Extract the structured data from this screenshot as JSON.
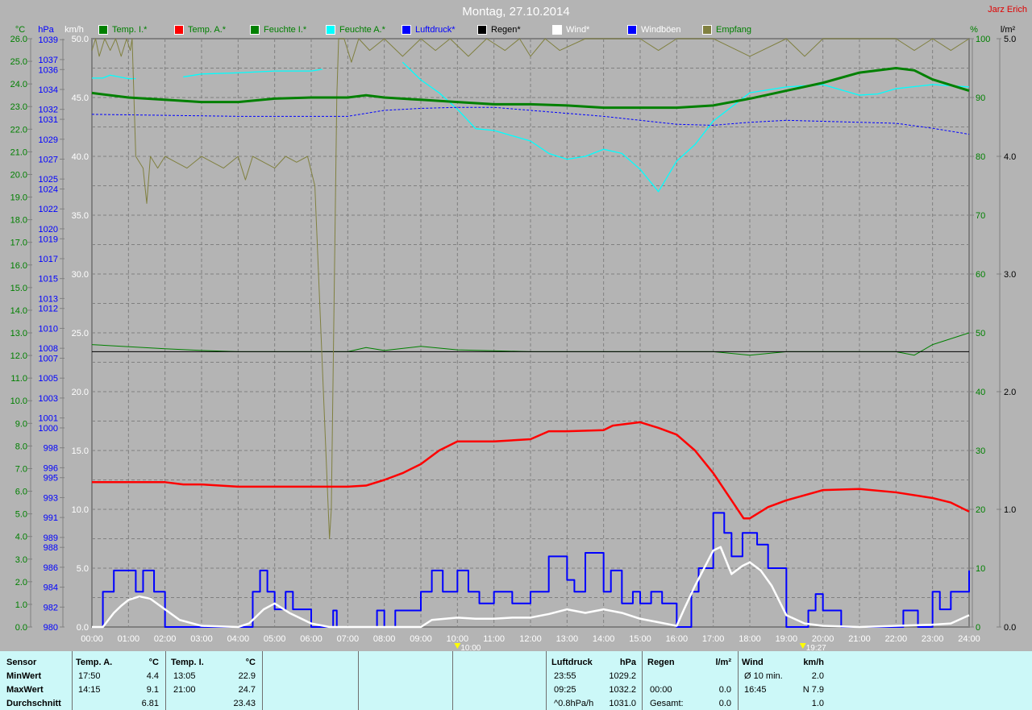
{
  "title": "Montag, 27.10.2014",
  "author": "Jarz Erich",
  "legend": [
    {
      "label": "Temp. I.*",
      "color": "#008000",
      "text_color": "#008000"
    },
    {
      "label": "Temp. A.*",
      "color": "#ff0000",
      "text_color": "#008000"
    },
    {
      "label": "Feuchte I.*",
      "color": "#008000",
      "text_color": "#008000"
    },
    {
      "label": "Feuchte A.*",
      "color": "#00ffff",
      "text_color": "#008000"
    },
    {
      "label": "Luftdruck*",
      "color": "#0000ff",
      "text_color": "#0000ff"
    },
    {
      "label": "Regen*",
      "color": "#000000",
      "text_color": "#000000"
    },
    {
      "label": "Wind*",
      "color": "#ffffff",
      "text_color": "#ffffff"
    },
    {
      "label": "Windböen",
      "color": "#0000ff",
      "text_color": "#ffffff"
    },
    {
      "label": "Empfang",
      "color": "#808040",
      "text_color": "#008000"
    }
  ],
  "chart_data": {
    "type": "line",
    "title": "Montag, 27.10.2014",
    "xlabel": "",
    "x_range": [
      0,
      24
    ],
    "x_ticks": [
      "00:00",
      "01:00",
      "02:00",
      "03:00",
      "04:00",
      "05:00",
      "06:00",
      "07:00",
      "08:00",
      "09:00",
      "10:00",
      "11:00",
      "12:00",
      "13:00",
      "14:00",
      "15:00",
      "16:00",
      "17:00",
      "18:00",
      "19:00",
      "20:00",
      "21:00",
      "22:00",
      "23:00",
      "24:00"
    ],
    "axes": {
      "temp": {
        "unit": "°C",
        "range": [
          0,
          26
        ],
        "ticks": [
          "0.0",
          "1.0",
          "2.0",
          "3.0",
          "4.0",
          "5.0",
          "6.0",
          "7.0",
          "8.0",
          "9.0",
          "10.0",
          "11.0",
          "12.0",
          "13.0",
          "14.0",
          "15.0",
          "16.0",
          "17.0",
          "18.0",
          "19.0",
          "20.0",
          "21.0",
          "22.0",
          "23.0",
          "24.0",
          "25.0",
          "26.0"
        ]
      },
      "pressure": {
        "unit": "hPa",
        "range": [
          980,
          1039.1
        ],
        "ticks": [
          980,
          982,
          984,
          986,
          988,
          989,
          991,
          993,
          995,
          996,
          998,
          1000,
          1001,
          1003,
          1005,
          1007,
          1008,
          1010,
          1012,
          1013,
          1015,
          1017,
          1019,
          1020,
          1022,
          1024,
          1025,
          1027,
          1029,
          1031,
          1032,
          1034,
          1036,
          1037,
          1039
        ]
      },
      "wind": {
        "unit": "km/h",
        "range": [
          0,
          50
        ],
        "ticks": [
          "0.0",
          "5.0",
          "10.0",
          "15.0",
          "20.0",
          "25.0",
          "30.0",
          "35.0",
          "40.0",
          "45.0",
          "50.0"
        ]
      },
      "humidity": {
        "unit": "%",
        "range": [
          0,
          100
        ],
        "ticks": [
          "0",
          "10",
          "20",
          "30",
          "40",
          "50",
          "60",
          "70",
          "80",
          "90",
          "100"
        ]
      },
      "rain": {
        "unit": "l/m²",
        "range": [
          0,
          5
        ],
        "ticks": [
          "0.0",
          "1.0",
          "2.0",
          "3.0",
          "4.0",
          "5.0"
        ]
      }
    },
    "markers": [
      {
        "label": "10:00",
        "x": 10
      },
      {
        "label": "19:27",
        "x": 19.45
      }
    ],
    "series": [
      {
        "name": "Feuchte I.",
        "axis": "humidity",
        "color": "#008000",
        "width": 1,
        "x": [
          0,
          2,
          3,
          4,
          7,
          7.5,
          8,
          9,
          10,
          12,
          17,
          18,
          19,
          22,
          22.5,
          23,
          24
        ],
        "y": [
          48,
          47.3,
          47,
          46.8,
          46.8,
          47.5,
          47,
          47.7,
          47.1,
          46.8,
          46.8,
          46.2,
          46.8,
          46.8,
          46.2,
          48,
          50
        ]
      },
      {
        "name": "Regen",
        "axis": "humidity",
        "color": "#000000",
        "width": 1,
        "x": [
          0,
          24
        ],
        "y": [
          46.8,
          46.8
        ]
      },
      {
        "name": "Feuchte A.",
        "axis": "humidity",
        "color": "#00ffff",
        "width": 1.3,
        "x": [
          0,
          0.3,
          0.5,
          1,
          1.2,
          null,
          2.5,
          3,
          4,
          5,
          6,
          6.3,
          null,
          8.5,
          9,
          9.5,
          10,
          10.5,
          11,
          12,
          12.5,
          13,
          13.5,
          14,
          14.5,
          15,
          15.5,
          16,
          16.5,
          17,
          18,
          19,
          20,
          21,
          21.5,
          22,
          23,
          24
        ],
        "y": [
          93.3,
          93.3,
          93.8,
          93.2,
          93.2,
          null,
          93.5,
          94,
          94.2,
          94.5,
          94.5,
          94.8,
          null,
          96,
          93,
          90.8,
          88,
          84.7,
          84.4,
          82.6,
          80.5,
          79.5,
          80,
          81.2,
          80.5,
          77.8,
          74,
          79.2,
          82,
          86,
          90.8,
          91.8,
          92.2,
          90.4,
          90.6,
          91.5,
          92.2,
          91.8
        ]
      },
      {
        "name": "Luftdruck",
        "axis": "pressure",
        "color": "#0000ff",
        "width": 1,
        "dash": true,
        "x": [
          0,
          2,
          4,
          7,
          8,
          9,
          10,
          11,
          12,
          13,
          14,
          15,
          16,
          17,
          18,
          19,
          20,
          21,
          22,
          23,
          24
        ],
        "y": [
          1031.5,
          1031.4,
          1031.3,
          1031.3,
          1031.9,
          1032.1,
          1032.2,
          1032.2,
          1031.9,
          1031.6,
          1031.3,
          1030.9,
          1030.5,
          1030.4,
          1030.7,
          1030.9,
          1030.8,
          1030.7,
          1030.6,
          1030.1,
          1029.5
        ]
      },
      {
        "name": "Empfang",
        "axis": "humidity",
        "color": "#808040",
        "width": 1,
        "x": [
          0,
          0.1,
          0.2,
          0.35,
          0.5,
          0.65,
          0.8,
          0.95,
          1.05,
          1.1,
          1.2,
          1.4,
          1.5,
          1.6,
          1.8,
          2,
          2.3,
          2.6,
          3,
          3.3,
          3.6,
          4,
          4.2,
          4.4,
          4.7,
          5,
          5.3,
          5.6,
          5.9,
          6.1,
          6.3,
          6.5,
          6.55,
          6.7,
          6.75,
          6.9,
          7.1,
          7.3,
          7.6,
          8,
          8.5,
          9,
          9.4,
          9.8,
          10.3,
          10.8,
          11.3,
          11.7,
          12,
          12.4,
          12.8,
          13.5,
          14,
          15,
          15.5,
          16,
          17,
          18,
          19,
          19.5,
          20,
          21,
          22,
          22.5,
          23,
          23.5,
          24
        ],
        "y": [
          98,
          100,
          97,
          100,
          98,
          100,
          97,
          100,
          98,
          100,
          80,
          78,
          72,
          80,
          78,
          80,
          79,
          78,
          80,
          79,
          78,
          80,
          76,
          80,
          79,
          78,
          80,
          79,
          80,
          75,
          45,
          15,
          20,
          90,
          100,
          100,
          96,
          100,
          98,
          100,
          97,
          100,
          98,
          100,
          97,
          100,
          98,
          100,
          97,
          100,
          98,
          100,
          100,
          100,
          98,
          100,
          100,
          97,
          100,
          97,
          100,
          100,
          100,
          98,
          100,
          98,
          100
        ]
      },
      {
        "name": "Temp. I.",
        "axis": "temp",
        "color": "#008000",
        "width": 3,
        "x": [
          0,
          1,
          2,
          3,
          4,
          5,
          6,
          7,
          7.5,
          8,
          9,
          10,
          11,
          12,
          13,
          14,
          15,
          16,
          17,
          18,
          19,
          20,
          21,
          22,
          22.5,
          23,
          24
        ],
        "y": [
          23.6,
          23.4,
          23.3,
          23.2,
          23.2,
          23.35,
          23.4,
          23.4,
          23.5,
          23.4,
          23.3,
          23.2,
          23.1,
          23.1,
          23.05,
          22.95,
          22.95,
          22.95,
          23.05,
          23.35,
          23.7,
          24.05,
          24.5,
          24.7,
          24.6,
          24.2,
          23.7
        ]
      },
      {
        "name": "Temp. A.",
        "axis": "temp",
        "color": "#ff0000",
        "width": 2.5,
        "x": [
          0,
          1,
          2,
          2.5,
          3,
          4,
          5,
          6,
          7,
          7.5,
          8,
          8.5,
          9,
          9.5,
          10,
          11,
          12,
          12.5,
          13,
          14,
          14.25,
          15,
          15.5,
          16,
          16.5,
          17,
          17.5,
          17.83,
          18,
          18.5,
          19,
          20,
          21,
          22,
          23,
          23.5,
          24
        ],
        "y": [
          6.4,
          6.4,
          6.4,
          6.3,
          6.3,
          6.2,
          6.2,
          6.2,
          6.2,
          6.25,
          6.5,
          6.8,
          7.2,
          7.8,
          8.2,
          8.2,
          8.3,
          8.65,
          8.65,
          8.7,
          8.9,
          9.05,
          8.8,
          8.5,
          7.8,
          6.8,
          5.6,
          4.8,
          4.8,
          5.3,
          5.6,
          6.05,
          6.1,
          5.95,
          5.7,
          5.5,
          5.1
        ]
      },
      {
        "name": "Windböen",
        "axis": "wind",
        "color": "#0000ff",
        "width": 2,
        "step": true,
        "x": [
          0,
          0.3,
          0.6,
          1.2,
          1.4,
          1.7,
          2,
          4.4,
          4.6,
          4.8,
          5,
          5.3,
          5.5,
          6,
          6.6,
          6.7,
          7.8,
          8,
          8.3,
          9,
          9.3,
          9.6,
          10,
          10.3,
          10.6,
          11,
          11.5,
          12,
          12.5,
          13,
          13.2,
          13.5,
          14,
          14.2,
          14.5,
          14.8,
          15,
          15.3,
          15.6,
          16,
          16.4,
          16.6,
          17,
          17.3,
          17.5,
          17.8,
          18.2,
          18.5,
          19,
          19.6,
          19.8,
          20,
          20.5,
          21,
          22.2,
          22.6,
          23,
          23.2,
          23.5,
          23.8,
          24
        ],
        "y": [
          0,
          3,
          4.8,
          3,
          4.8,
          3,
          0,
          3,
          4.8,
          3,
          1.5,
          3,
          1.5,
          0,
          1.4,
          0,
          1.4,
          0,
          1.4,
          3,
          4.8,
          3,
          4.8,
          3,
          2,
          3,
          2,
          3,
          6,
          4,
          3,
          6.3,
          3,
          4.8,
          2,
          3,
          2,
          3,
          2,
          0,
          3,
          5,
          9.7,
          8,
          6,
          8,
          7,
          5,
          0,
          1.4,
          2.8,
          1.4,
          0,
          0,
          1.4,
          0,
          3,
          1.5,
          3,
          3,
          4.8
        ]
      },
      {
        "name": "Wind",
        "axis": "wind",
        "color": "#ffffff",
        "width": 2.5,
        "x": [
          0,
          0.3,
          0.6,
          0.8,
          1,
          1.3,
          1.6,
          2,
          2.4,
          3,
          4,
          4.3,
          4.7,
          5,
          5.4,
          6,
          6.5,
          9,
          9.3,
          10,
          10.5,
          11,
          11.5,
          12,
          12.5,
          13,
          13.5,
          14,
          14.5,
          15,
          15.5,
          16,
          16.2,
          16.5,
          16.8,
          17,
          17.2,
          17.5,
          17.8,
          18,
          18.3,
          18.6,
          19,
          19.5,
          20,
          21,
          23,
          23.5,
          24
        ],
        "y": [
          0,
          0,
          1.2,
          1.8,
          2.3,
          2.6,
          2.4,
          1.5,
          0.6,
          0.1,
          0,
          0.3,
          1.5,
          2.0,
          1.2,
          0.3,
          0,
          0,
          0.6,
          0.8,
          0.7,
          0.7,
          0.8,
          0.8,
          1.1,
          1.5,
          1.2,
          1.5,
          1.2,
          0.7,
          0.4,
          0.1,
          1.5,
          3.5,
          5.3,
          6.5,
          6.8,
          4.5,
          5.2,
          5.5,
          4.8,
          3.5,
          1,
          0.3,
          0.1,
          0,
          0.2,
          0.3,
          1
        ]
      }
    ]
  },
  "table": {
    "headers": {
      "sensor": "Sensor",
      "temp_a": "Temp. A.",
      "temp_a_unit": "°C",
      "temp_i": "Temp. I.",
      "temp_i_unit": "°C",
      "pressure": "Luftdruck",
      "pressure_unit": "hPa",
      "rain": "Regen",
      "rain_unit": "l/m²",
      "wind": "Wind",
      "wind_unit": "km/h"
    },
    "rows": [
      "MinWert",
      "MaxWert",
      "Durchschnitt"
    ],
    "temp_a": [
      [
        "17:50",
        "4.4"
      ],
      [
        "14:15",
        "9.1"
      ],
      [
        "",
        "6.81"
      ]
    ],
    "temp_i": [
      [
        "13:05",
        "22.9"
      ],
      [
        "21:00",
        "24.7"
      ],
      [
        "",
        "23.43"
      ]
    ],
    "pressure": [
      [
        "23:55",
        "1029.2"
      ],
      [
        "09:25",
        "1032.2"
      ],
      [
        "^0.8hPa/h",
        "1031.0"
      ]
    ],
    "rain": [
      [
        "",
        ""
      ],
      [
        "00:00",
        "0.0"
      ],
      [
        "Gesamt:",
        "0.0"
      ]
    ],
    "wind": [
      [
        "Ø 10 min.",
        "2.0"
      ],
      [
        "16:45",
        "N 7.9"
      ],
      [
        "",
        "1.0"
      ]
    ]
  }
}
